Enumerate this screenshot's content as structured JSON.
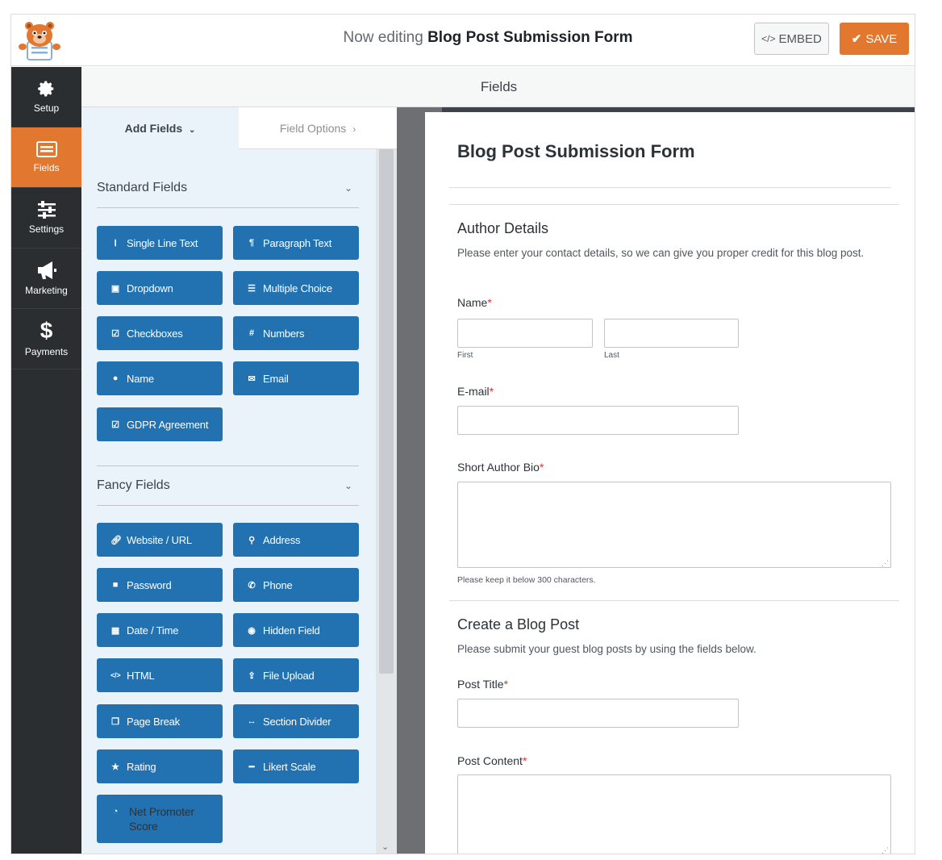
{
  "header": {
    "title_prefix": "Now editing",
    "title_form": "Blog Post Submission Form",
    "embed_label": "EMBED",
    "save_label": "SAVE"
  },
  "sidebar": {
    "items": [
      {
        "label": "Setup",
        "icon": "gear-icon"
      },
      {
        "label": "Fields",
        "icon": "fields-icon",
        "active": true
      },
      {
        "label": "Settings",
        "icon": "sliders-icon"
      },
      {
        "label": "Marketing",
        "icon": "megaphone-icon"
      },
      {
        "label": "Payments",
        "icon": "dollar-icon"
      }
    ]
  },
  "fields_header": "Fields",
  "panel": {
    "tabs": {
      "add": "Add Fields",
      "options": "Field Options"
    },
    "standard": {
      "title": "Standard Fields",
      "buttons": [
        "Single Line Text",
        "Paragraph Text",
        "Dropdown",
        "Multiple Choice",
        "Checkboxes",
        "Numbers",
        "Name",
        "Email",
        "GDPR Agreement"
      ]
    },
    "fancy": {
      "title": "Fancy Fields",
      "buttons": [
        "Website / URL",
        "Address",
        "Password",
        "Phone",
        "Date / Time",
        "Hidden Field",
        "HTML",
        "File Upload",
        "Page Break",
        "Section Divider",
        "Rating",
        "Likert Scale",
        "Net Promoter Score"
      ]
    }
  },
  "preview": {
    "form_title": "Blog Post Submission Form",
    "section1": {
      "title": "Author Details",
      "desc": "Please enter your contact details, so we can give you proper credit for this blog post."
    },
    "name": {
      "label": "Name",
      "req": "*",
      "first": "First",
      "last": "Last"
    },
    "email": {
      "label": "E-mail",
      "req": "*"
    },
    "bio": {
      "label": "Short Author Bio",
      "req": "*",
      "hint": "Please keep it below 300 characters."
    },
    "section2": {
      "title": "Create a Blog Post",
      "desc": "Please submit your guest blog posts by using the fields below."
    },
    "post_title": {
      "label": "Post Title",
      "req": "*"
    },
    "post_content": {
      "label": "Post Content",
      "req": "*"
    }
  },
  "colors": {
    "accent": "#e27730",
    "button_blue": "#2271b1",
    "sidebar": "#2b2e31"
  }
}
